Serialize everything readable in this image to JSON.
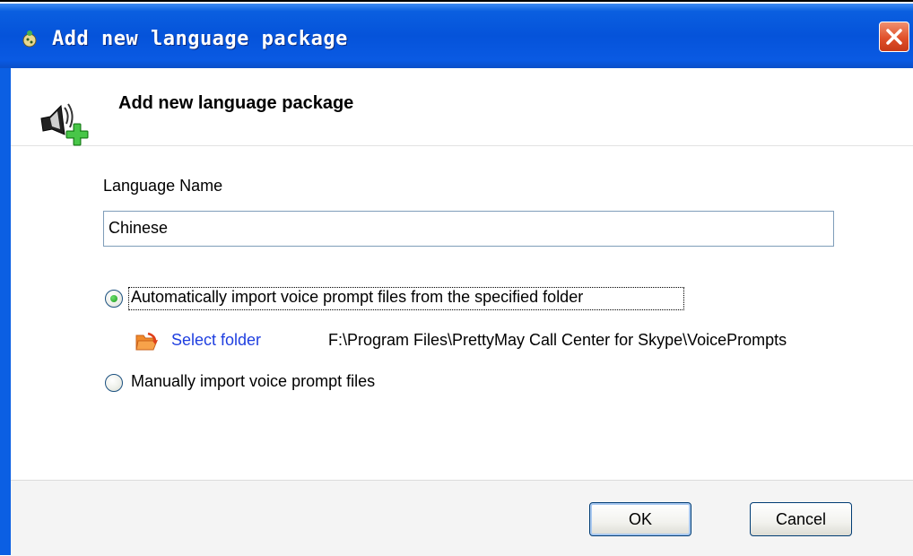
{
  "window": {
    "title": "Add new language package",
    "close_icon": "close-icon"
  },
  "header": {
    "title": "Add new language package",
    "icon": "speaker-add-icon"
  },
  "form": {
    "language_name_label": "Language Name",
    "language_name_value": "Chinese",
    "options": [
      {
        "label": "Automatically import voice prompt files from the specified folder",
        "selected": true
      },
      {
        "label": "Manually import voice prompt files",
        "selected": false
      }
    ],
    "select_folder_label": "Select folder",
    "folder_icon": "folder-icon",
    "folder_path": "F:\\Program Files\\PrettyMay Call Center for Skype\\VoicePrompts"
  },
  "footer": {
    "ok_label": "OK",
    "cancel_label": "Cancel"
  },
  "colors": {
    "titlebar": "#0553da",
    "link": "#1f3fe0",
    "close": "#e0502a"
  }
}
